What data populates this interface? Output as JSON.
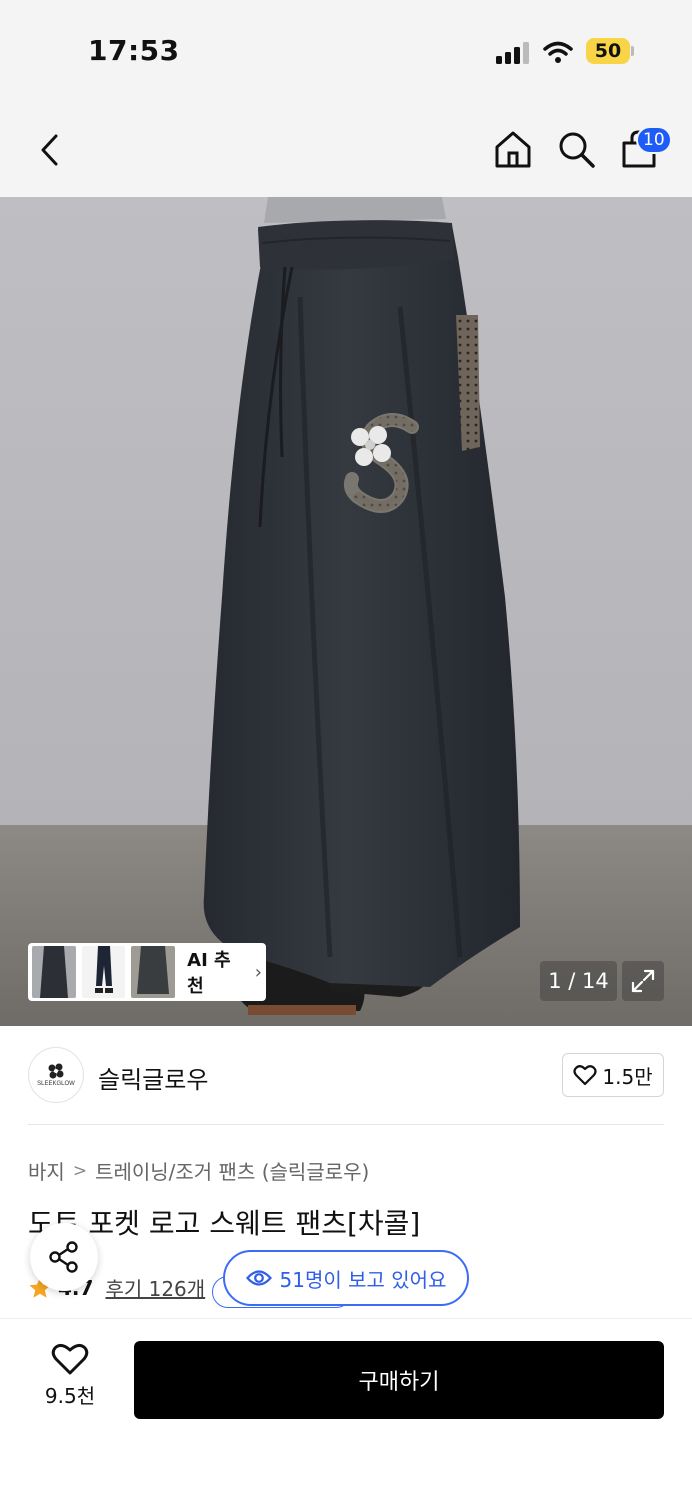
{
  "status_bar": {
    "time": "17:53",
    "battery": "50",
    "icons": [
      "cellular-signal-icon",
      "wifi-icon",
      "battery-icon"
    ]
  },
  "nav": {
    "icons": [
      "back-chevron-icon",
      "home-icon",
      "search-icon",
      "shopping-bag-icon"
    ],
    "cart_count": "10"
  },
  "hero": {
    "ai_recommend_label": "AI 추천",
    "page_counter": "1 / 14",
    "thumbnails": 3
  },
  "brand": {
    "name": "슬릭글로우",
    "logo_text": "SLEEKGLOW",
    "likes": "1.5만"
  },
  "product": {
    "breadcrumb": [
      "바지",
      "트레이닝/조거 팬츠 (슬릭글로우)"
    ],
    "title": "도트 포켓 로고 스웨트 팬츠[차콜]",
    "rating": "4.7",
    "reviews": "후기 126개",
    "viewers": "51명이 보고 있어요"
  },
  "bottom_bar": {
    "wish_count": "9.5천",
    "buy_label": "구매하기"
  },
  "colors": {
    "accent_blue": "#1d5cf6",
    "pill_blue": "#2f5ee8",
    "star": "#f5a623",
    "buy_button": "#000000"
  }
}
